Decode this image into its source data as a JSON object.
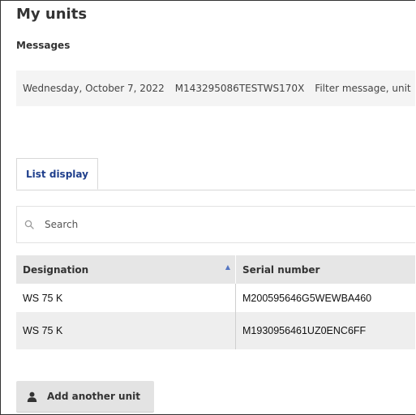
{
  "page": {
    "title": "My units"
  },
  "messages": {
    "heading": "Messages",
    "date": "Wednesday, October 7, 2022",
    "serial": "M143295086TESTWS170X",
    "text": "Filter message, unit"
  },
  "tabs": [
    {
      "label": "List display",
      "active": true
    }
  ],
  "search": {
    "placeholder": "Search",
    "value": "",
    "icon": "search-icon"
  },
  "table": {
    "columns": [
      "Designation",
      "Serial number"
    ],
    "sort": {
      "column": "Designation",
      "direction": "ascending"
    },
    "rows": [
      {
        "designation": "WS 75 K",
        "serial": "M200595646G5WEWBA460"
      },
      {
        "designation": "WS 75 K",
        "serial": "M1930956461UZ0ENC6FF"
      }
    ]
  },
  "actions": {
    "add_unit_label": "Add another unit",
    "add_unit_icon": "user-icon"
  },
  "colors": {
    "tab_active_text": "#1f3f8c",
    "sort_arrow": "#5576c2",
    "header_bg": "#e6e6e6",
    "message_bg": "#f4f4f4"
  }
}
